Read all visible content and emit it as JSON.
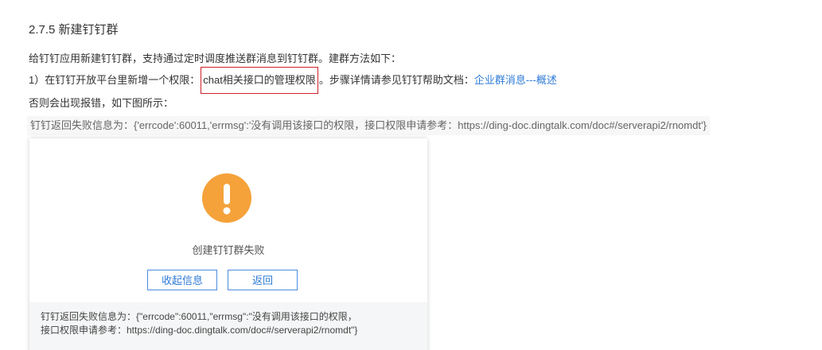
{
  "heading": "2.7.5 新建钉钉群",
  "intro": "给钉钉应用新建钉钉群，支持通过定时调度推送群消息到钉钉群。建群方法如下：",
  "step1": {
    "prefix": "1）在钉钉开放平台里新增一个权限：",
    "highlight": "chat相关接口的管理权限",
    "suffix": "。步骤详情请参见钉钉帮助文档：",
    "link": "企业群消息---概述"
  },
  "note": "否则会出现报错，如下图所示：",
  "error_message": "钉钉返回失败信息为：{'errcode':60011,'errmsg':'没有调用该接口的权限，接口权限申请参考：https://ding-doc.dingtalk.com/doc#/serverapi2/rnomdt'}",
  "dialog": {
    "title": "创建钉钉群失败",
    "collapse_label": "收起信息",
    "back_label": "返回",
    "detail_line1": "钉钉返回失败信息为：{\"errcode\":60011,\"errmsg\":\"没有调用该接口的权限，",
    "detail_line2": "接口权限申请参考：https://ding-doc.dingtalk.com/doc#/serverapi2/rnomdt\"}",
    "icon": "warning-icon",
    "icon_color": "#f5a23a"
  },
  "colors": {
    "link": "#2e7bd6",
    "highlight_border": "#d0202a"
  }
}
